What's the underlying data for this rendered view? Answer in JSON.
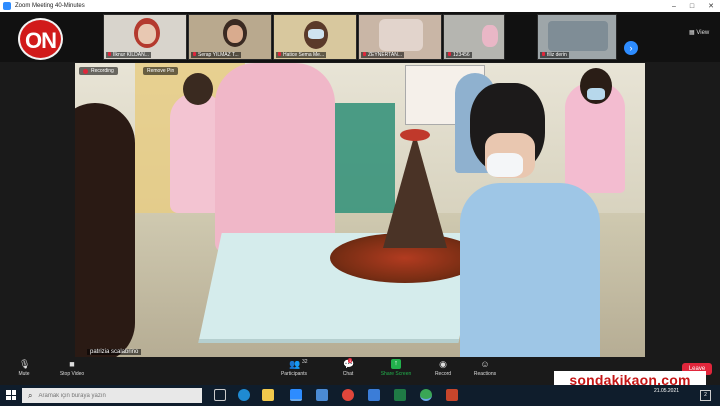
{
  "window": {
    "title": "Zoom Meeting 40-Minutes",
    "buttons": [
      "–",
      "□",
      "✕"
    ]
  },
  "brand": {
    "logo_text": "ON"
  },
  "gallery": {
    "participants": [
      {
        "name": "İlknur KILDAN...",
        "muted": true
      },
      {
        "name": "Serap YILMAZ T...",
        "muted": true
      },
      {
        "name": "Hatice Sema Me...",
        "muted": true
      },
      {
        "name": "ZEYNERTAN...",
        "muted": true
      },
      {
        "name": "123456",
        "muted": true
      },
      {
        "name": "filiz derin",
        "muted": true
      }
    ],
    "next_label": "›",
    "view_label": "View"
  },
  "main_video": {
    "recording_label": "Recording",
    "remove_pin_label": "Remove Pin",
    "speaker_name": "patrizia scalabrino"
  },
  "controls": {
    "mute": {
      "label": "Mute",
      "icon": "microphone-icon"
    },
    "video": {
      "label": "Stop Video",
      "icon": "video-camera-icon"
    },
    "participants": {
      "label": "Participants",
      "count": "32",
      "icon": "people-icon"
    },
    "chat": {
      "label": "Chat",
      "badge": "1",
      "icon": "chat-icon"
    },
    "share": {
      "label": "Share Screen",
      "icon": "share-screen-icon"
    },
    "record": {
      "label": "Record",
      "icon": "record-icon"
    },
    "reactions": {
      "label": "Reactions",
      "icon": "smiley-icon"
    },
    "leave": {
      "label": "Leave"
    }
  },
  "watermark": {
    "text": "sondakikaon.com"
  },
  "taskbar": {
    "search_placeholder": "Aramak için buraya yazın",
    "date": "21.05.2021",
    "notification_count": "2",
    "colors": {
      "taskbar_bg": "#0f1d2c",
      "accent": "#2d8cff",
      "leave": "#e0263b",
      "share": "#22b14c"
    }
  }
}
